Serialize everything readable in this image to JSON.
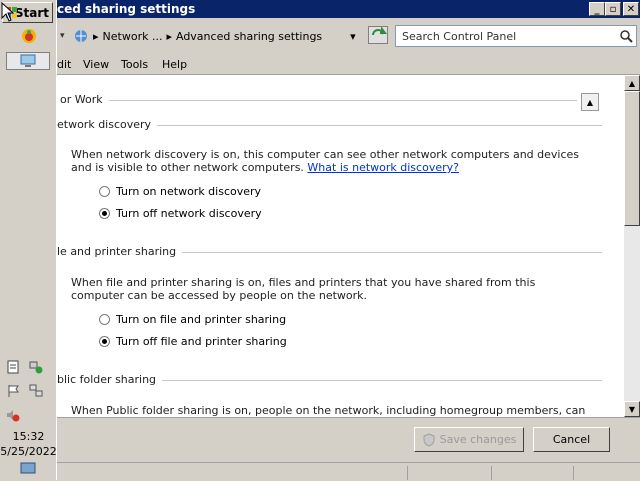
{
  "taskbar": {
    "start_label": "Start",
    "clock_time": "15:32",
    "clock_date": "5/25/2022"
  },
  "window": {
    "title": "ced sharing settings",
    "address_segments": [
      "Network ...",
      "Advanced sharing settings"
    ],
    "search_placeholder": "Search Control Panel",
    "menu": [
      "dit",
      "View",
      "Tools",
      "Help"
    ]
  },
  "content": {
    "profile_title": "or Work",
    "network_discovery": {
      "title": "etwork discovery",
      "description": "When network discovery is on, this computer can see other network computers and devices and is visible to other network computers.",
      "link": "What is network discovery?",
      "options": [
        "Turn on network discovery",
        "Turn off network discovery"
      ],
      "selected_index": 1
    },
    "file_printer": {
      "title": "le and printer sharing",
      "description": "When file and printer sharing is on, files and printers that you have shared from this computer can be accessed by people on the network.",
      "options": [
        "Turn on file and printer sharing",
        "Turn off file and printer sharing"
      ],
      "selected_index": 1
    },
    "public_folder": {
      "title": "blic folder sharing",
      "description": "When Public folder sharing is on, people on the network, including homegroup members, can access files in"
    }
  },
  "footer": {
    "save_label": "Save changes",
    "cancel_label": "Cancel"
  },
  "colors": {
    "titlebar": "#0a246a",
    "link": "#0033cc"
  }
}
